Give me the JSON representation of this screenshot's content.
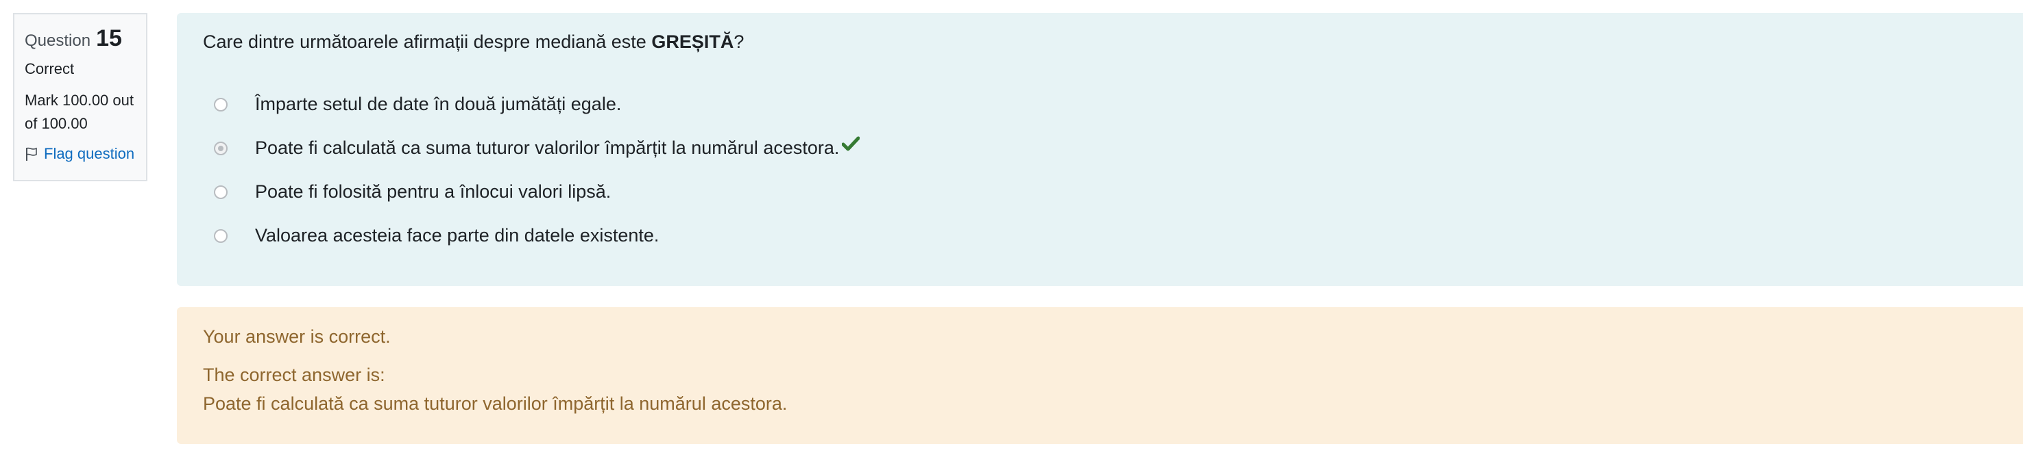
{
  "info": {
    "question_label": "Question",
    "question_number": "15",
    "state": "Correct",
    "grade_line1": "Mark 100.00 out",
    "grade_line2": "of 100.00",
    "flag_label": "Flag question"
  },
  "question": {
    "text_before": "Care dintre următoarele afirmații despre mediană este ",
    "text_bold": "GREȘITĂ",
    "text_after": "?",
    "answers": [
      {
        "label": "Împarte setul de date în două jumătăți egale.",
        "selected": false,
        "correct_mark": false
      },
      {
        "label": "Poate fi calculată ca suma tuturor valorilor împărțit la numărul acestora.",
        "selected": true,
        "correct_mark": true
      },
      {
        "label": "Poate fi folosită pentru a înlocui valori lipsă.",
        "selected": false,
        "correct_mark": false
      },
      {
        "label": "Valoarea acesteia face parte din datele existente.",
        "selected": false,
        "correct_mark": false
      }
    ]
  },
  "feedback": {
    "result": "Your answer is correct.",
    "correct_answer_label": "The correct answer is:",
    "correct_answer_text": "Poate fi calculată ca suma tuturor valorilor împărțit la numărul acestora."
  },
  "colors": {
    "question_bg": "#e7f3f5",
    "feedback_bg": "#fcefdc",
    "feedback_text": "#8e662e",
    "link": "#0f6cbf",
    "check": "#357a32"
  },
  "icons": {
    "flag": "flag-icon",
    "correct": "check-icon"
  }
}
